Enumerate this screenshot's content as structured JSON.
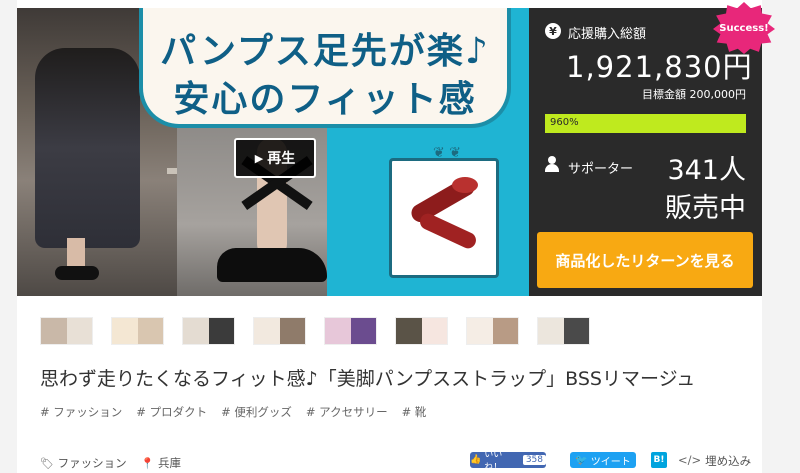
{
  "hero": {
    "banner_line1": "パンプス足先が楽♪",
    "banner_line2": "安心のフィット感",
    "play_label": "再生",
    "play_icon": "play-triangle"
  },
  "stats": {
    "success_badge": "Success!",
    "total_label": "応援購入総額",
    "total_amount": "1,921,830円",
    "goal_text": "目標金額 200,000円",
    "progress_percent_label": "960%",
    "progress_value": 1.0,
    "supporters_label": "サポーター",
    "supporters_count": "341人",
    "status_text": "販売中",
    "return_button": "商品化したリターンを見る",
    "colors": {
      "panel": "#2a2a2a",
      "progress": "#bfea1e",
      "button": "#f8a912",
      "badge": "#e8277a"
    }
  },
  "thumbnails": [
    {
      "a": "#c9b8a8",
      "b": "#e8e0d6"
    },
    {
      "a": "#f4e7d3",
      "b": "#d9c6b0"
    },
    {
      "a": "#e4dcd2",
      "b": "#3b3b3b"
    },
    {
      "a": "#f2e9df",
      "b": "#8f7b6a"
    },
    {
      "a": "#e7c7d9",
      "b": "#6b4c8f"
    },
    {
      "a": "#5a5347",
      "b": "#f6e6e0"
    },
    {
      "a": "#f5ede5",
      "b": "#b89b85"
    },
    {
      "a": "#ece6dd",
      "b": "#4a4a4a"
    }
  ],
  "project": {
    "title": "思わず走りたくなるフィット感♪「美脚パンプスストラップ」BSSリマージュ",
    "tags": [
      "# ファッション",
      "# プロダクト",
      "# 便利グッズ",
      "# アクセサリー",
      "# 靴"
    ],
    "category": "ファッション",
    "location": "兵庫"
  },
  "share": {
    "like_label": "いいね！",
    "like_count": "358",
    "tweet_label": "ツイート",
    "hatena_label": "B!",
    "embed_label": "埋め込み"
  }
}
